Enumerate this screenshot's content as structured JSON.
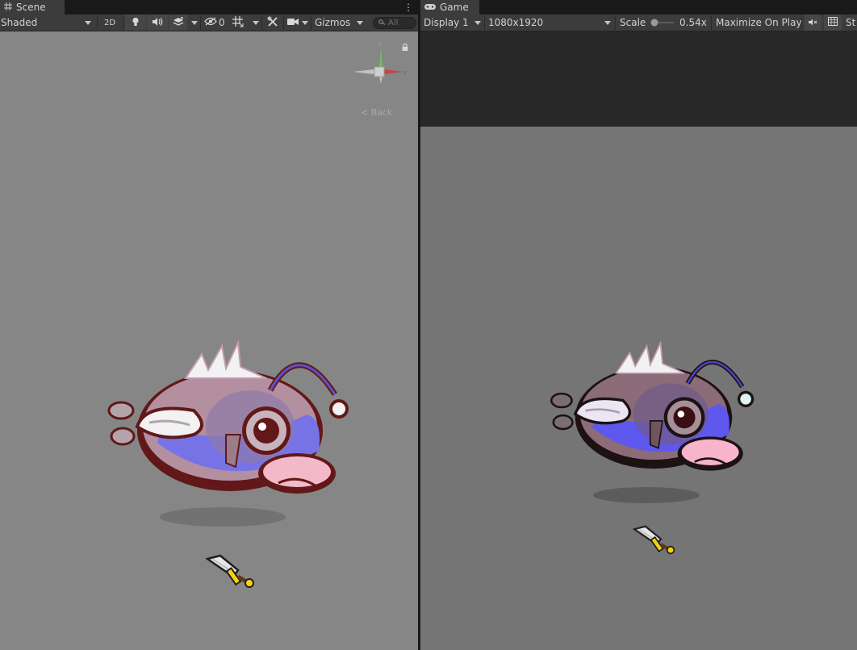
{
  "scene": {
    "tab_label": "Scene",
    "toolbar": {
      "draw_mode": "Shaded",
      "mode_2d": "2D",
      "hidden_count": "0",
      "gizmos_label": "Gizmos",
      "search_placeholder": "All"
    },
    "gizmo": {
      "back_label": "< Back"
    }
  },
  "game": {
    "tab_label": "Game",
    "toolbar": {
      "display": "Display 1",
      "resolution": "1080x1920",
      "scale_label": "Scale",
      "scale_value": "0.54x",
      "maximize_label": "Maximize On Play",
      "stats_label": "St"
    }
  },
  "colors": {
    "panel_bg": "#3c3c3c",
    "scene_bg": "#868686",
    "game_bg": "#757575",
    "game_letterbox": "#282828",
    "axis_x": "#c84444",
    "axis_y": "#63c14a",
    "fish_body": "#7773e6",
    "fish_outline": "#621818",
    "fish_lip": "#f4b9c9",
    "sword_hilt": "#f5d20f"
  },
  "icons": [
    "grid-icon",
    "gamepad-icon",
    "lightbulb-icon",
    "audio-icon",
    "effects-icon",
    "visibility-icon",
    "grid-snap-icon",
    "tools-icon",
    "camera-icon",
    "search-icon",
    "lock-icon",
    "kebab-menu-icon",
    "mute-audio-icon",
    "stats-icon"
  ]
}
